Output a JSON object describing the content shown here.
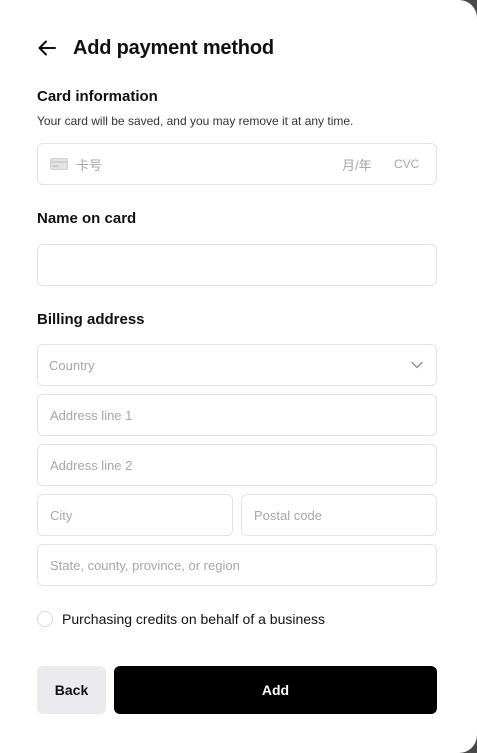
{
  "header": {
    "title": "Add payment method"
  },
  "card_section": {
    "label": "Card information",
    "subtext": "Your card will be saved, and you may remove it at any time.",
    "card_number_placeholder": "卡号",
    "expiry_placeholder": "月/年",
    "cvc_placeholder": "CVC"
  },
  "name_section": {
    "label": "Name on card",
    "value": ""
  },
  "billing_section": {
    "label": "Billing address",
    "country_placeholder": "Country",
    "address1_placeholder": "Address line 1",
    "address2_placeholder": "Address line 2",
    "city_placeholder": "City",
    "postal_placeholder": "Postal code",
    "state_placeholder": "State, county, province, or region"
  },
  "business_option": {
    "label": "Purchasing credits on behalf of a business",
    "checked": false
  },
  "actions": {
    "back_label": "Back",
    "add_label": "Add"
  },
  "colors": {
    "primary_button": "#000000",
    "secondary_button": "#ebebef",
    "border": "#e3e3e6",
    "placeholder": "#a6a6ab"
  },
  "icons": {
    "back": "arrow-left-icon",
    "card": "credit-card-icon",
    "dropdown": "chevron-down-icon"
  }
}
